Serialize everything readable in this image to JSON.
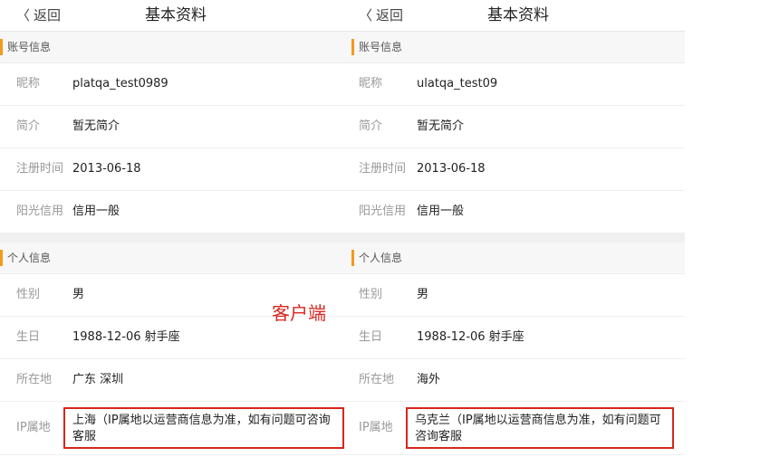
{
  "left": {
    "back_label": "返回",
    "title": "基本资料",
    "account_section": "账号信息",
    "account_rows": [
      {
        "key": "昵称",
        "value": "platqa_test0989"
      },
      {
        "key": "简介",
        "value": "暂无简介"
      },
      {
        "key": "注册时间",
        "value": "2013-06-18"
      },
      {
        "key": "阳光信用",
        "value": "信用一般"
      }
    ],
    "personal_section": "个人信息",
    "personal_rows": [
      {
        "key": "性别",
        "value": "男"
      },
      {
        "key": "生日",
        "value": "1988-12-06 射手座"
      },
      {
        "key": "所在地",
        "value": "广东 深圳"
      }
    ],
    "ip": {
      "key": "IP属地",
      "value": "上海（IP属地以运营商信息为准，如有问题可咨询客服"
    }
  },
  "right": {
    "back_label": "返回",
    "title": "基本资料",
    "account_section": "账号信息",
    "account_rows": [
      {
        "key": "昵称",
        "value": "ulatqa_test09"
      },
      {
        "key": "简介",
        "value": "暂无简介"
      },
      {
        "key": "注册时间",
        "value": "2013-06-18"
      },
      {
        "key": "阳光信用",
        "value": "信用一般"
      }
    ],
    "personal_section": "个人信息",
    "personal_rows": [
      {
        "key": "性别",
        "value": "男"
      },
      {
        "key": "生日",
        "value": "1988-12-06 射手座"
      },
      {
        "key": "所在地",
        "value": "海外"
      }
    ],
    "ip": {
      "key": "IP属地",
      "value": "乌克兰（IP属地以运营商信息为准，如有问题可咨询客服"
    }
  },
  "annotation": "客户端",
  "colors": {
    "accent": "#f39a1c",
    "highlight": "#d8261d"
  }
}
